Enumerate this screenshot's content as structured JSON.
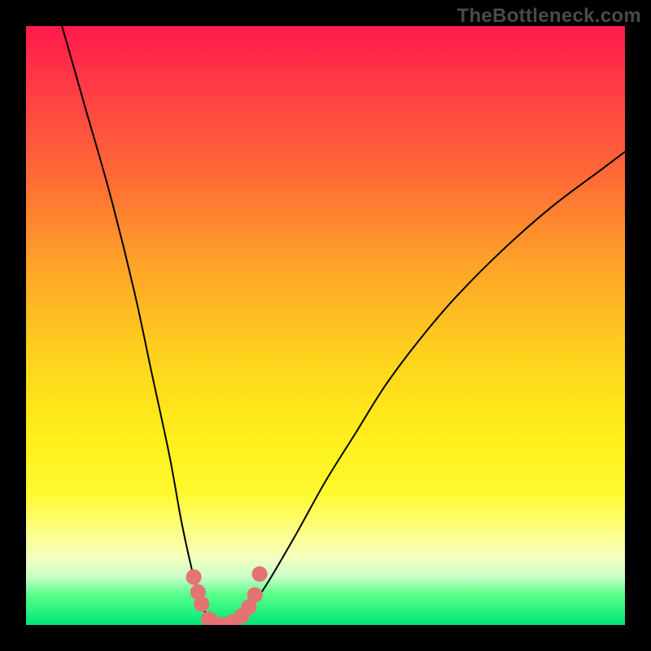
{
  "watermark": {
    "text": "TheBottleneck.com"
  },
  "colors": {
    "frame": "#000000",
    "curve": "#000000",
    "marker": "#e57373",
    "gradient_top": "#ff1a4d",
    "gradient_bottom": "#00e676"
  },
  "chart_data": {
    "type": "line",
    "title": "",
    "xlabel": "",
    "ylabel": "",
    "xlim": [
      0,
      100
    ],
    "ylim": [
      0,
      100
    ],
    "grid": false,
    "legend": false,
    "note": "Axes unlabeled; x is horizontal position (0–100 left→right), y is bottleneck % (0 at bottom, 100 at top). Values estimated from pixel positions.",
    "series": [
      {
        "name": "bottleneck-curve",
        "x": [
          6,
          10,
          14,
          18,
          21,
          24,
          26,
          28,
          29.5,
          31,
          33,
          35,
          37,
          40,
          45,
          50,
          55,
          60,
          66,
          72,
          80,
          88,
          96,
          100
        ],
        "y": [
          100,
          86,
          72,
          56,
          42,
          28,
          17,
          8,
          3,
          0.5,
          0,
          0.7,
          2.5,
          6.5,
          15,
          24,
          32,
          40,
          48,
          55,
          63,
          70,
          76,
          79
        ]
      },
      {
        "name": "optimal-markers",
        "type": "scatter",
        "x": [
          28.0,
          28.7,
          29.3,
          30.5,
          31.5,
          33.0,
          34.5,
          36.0,
          37.2,
          38.2,
          39.0
        ],
        "y": [
          8.0,
          5.5,
          3.5,
          1.0,
          0.3,
          0.0,
          0.5,
          1.5,
          3.0,
          5.0,
          8.5
        ]
      }
    ]
  }
}
